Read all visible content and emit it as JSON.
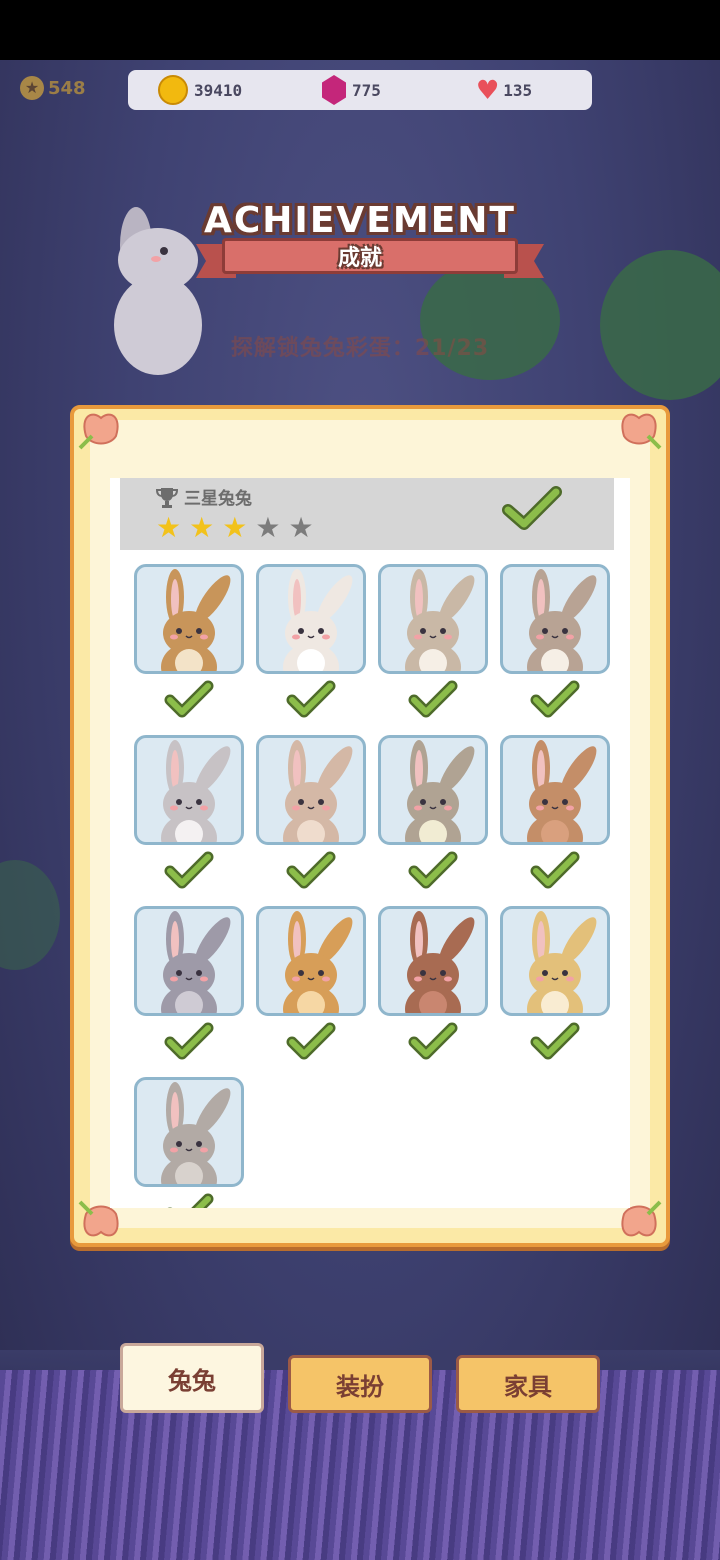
{
  "level": {
    "value": "548"
  },
  "currency": {
    "coins": "39410",
    "gems": "775",
    "hearts": "135"
  },
  "header": {
    "title": "ACHIEVEMENT",
    "subtitle": "成就",
    "progress": "探解锁兔兔彩蛋：21/23"
  },
  "achievement": {
    "name": "三星兔兔",
    "stars_total": 5,
    "stars_filled": 3,
    "completed": true
  },
  "bunnies": [
    {
      "color": "#c8955a",
      "belly": "#f3e3c8",
      "collected": true
    },
    {
      "color": "#efe8e2",
      "belly": "#ffffff",
      "collected": true
    },
    {
      "color": "#c9b8a6",
      "belly": "#f6efe6",
      "collected": true
    },
    {
      "color": "#b8a394",
      "belly": "#f6efe6",
      "collected": true
    },
    {
      "color": "#c7c2c5",
      "belly": "#f4f1f2",
      "collected": true
    },
    {
      "color": "#d4b8a6",
      "belly": "#efdccd",
      "collected": true
    },
    {
      "color": "#b0a393",
      "belly": "#f1ecd3",
      "collected": true
    },
    {
      "color": "#c48e68",
      "belly": "#d9a07e",
      "collected": true
    },
    {
      "color": "#9e9aa8",
      "belly": "#cfcbd4",
      "collected": true
    },
    {
      "color": "#d79e58",
      "belly": "#f6d7a4",
      "collected": true
    },
    {
      "color": "#a86b52",
      "belly": "#c98670",
      "collected": true
    },
    {
      "color": "#e3c07a",
      "belly": "#f9ecd2",
      "collected": true
    },
    {
      "color": "#b2aaa5",
      "belly": "#d8d2cd",
      "collected": true
    }
  ],
  "tabs": [
    {
      "label": "兔兔",
      "active": true
    },
    {
      "label": "装扮",
      "active": false
    },
    {
      "label": "家具",
      "active": false
    }
  ],
  "colors": {
    "check": "#8cbd4a",
    "card_border": "#8fb6cc",
    "panel_border": "#e89a3c"
  }
}
